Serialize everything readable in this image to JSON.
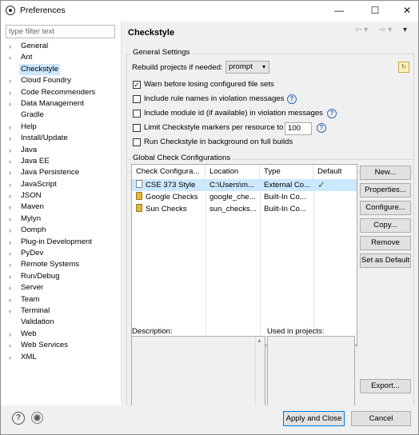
{
  "window": {
    "title": "Preferences"
  },
  "filter": {
    "placeholder": "type filter text"
  },
  "tree": [
    {
      "label": "General",
      "expandable": true
    },
    {
      "label": "Ant",
      "expandable": true
    },
    {
      "label": "Checkstyle",
      "expandable": false,
      "selected": true
    },
    {
      "label": "Cloud Foundry",
      "expandable": true
    },
    {
      "label": "Code Recommenders",
      "expandable": true
    },
    {
      "label": "Data Management",
      "expandable": true
    },
    {
      "label": "Gradle",
      "expandable": false
    },
    {
      "label": "Help",
      "expandable": true
    },
    {
      "label": "Install/Update",
      "expandable": true
    },
    {
      "label": "Java",
      "expandable": true
    },
    {
      "label": "Java EE",
      "expandable": true
    },
    {
      "label": "Java Persistence",
      "expandable": true
    },
    {
      "label": "JavaScript",
      "expandable": true
    },
    {
      "label": "JSON",
      "expandable": true
    },
    {
      "label": "Maven",
      "expandable": true
    },
    {
      "label": "Mylyn",
      "expandable": true
    },
    {
      "label": "Oomph",
      "expandable": true
    },
    {
      "label": "Plug-in Development",
      "expandable": true
    },
    {
      "label": "PyDev",
      "expandable": true
    },
    {
      "label": "Remote Systems",
      "expandable": true
    },
    {
      "label": "Run/Debug",
      "expandable": true
    },
    {
      "label": "Server",
      "expandable": true
    },
    {
      "label": "Team",
      "expandable": true
    },
    {
      "label": "Terminal",
      "expandable": true
    },
    {
      "label": "Validation",
      "expandable": false
    },
    {
      "label": "Web",
      "expandable": true
    },
    {
      "label": "Web Services",
      "expandable": true
    },
    {
      "label": "XML",
      "expandable": true
    }
  ],
  "page": {
    "title": "Checkstyle"
  },
  "general": {
    "group_label": "General Settings",
    "rebuild_label": "Rebuild projects if needed:",
    "rebuild_value": "prompt",
    "options": [
      {
        "label": "Warn before losing configured file sets",
        "checked": true,
        "help": false
      },
      {
        "label": "Include rule names in violation messages",
        "checked": false,
        "help": true
      },
      {
        "label": "Include module id (if available) in violation messages",
        "checked": false,
        "help": true
      },
      {
        "label": "Limit Checkstyle markers per resource to",
        "checked": false,
        "help": true,
        "value": "100"
      },
      {
        "label": "Run Checkstyle in background on full builds",
        "checked": false,
        "help": false
      }
    ]
  },
  "global": {
    "group_label": "Global Check Configurations",
    "columns": [
      "Check Configura...",
      "Location",
      "Type",
      "Default"
    ],
    "rows": [
      {
        "name": "CSE 373 Style",
        "location": "C:\\Users\\m...",
        "type": "External Co...",
        "default": "✓",
        "selected": true,
        "icon": "file-icon"
      },
      {
        "name": "Google Checks",
        "location": "google_che...",
        "type": "Built-In Co...",
        "default": "",
        "selected": false,
        "icon": "lock-icon"
      },
      {
        "name": "Sun Checks",
        "location": "sun_checks...",
        "type": "Built-In Co...",
        "default": "",
        "selected": false,
        "icon": "lock-icon"
      }
    ],
    "buttons": {
      "new": "New...",
      "properties": "Properties...",
      "configure": "Configure...",
      "copy": "Copy...",
      "remove": "Remove",
      "set_default": "Set as Default",
      "export": "Export..."
    },
    "description_label": "Description:",
    "used_label": "Used in projects:"
  },
  "footer": {
    "apply_close": "Apply and Close",
    "cancel": "Cancel"
  },
  "colors": {
    "selection": "#cce8ff",
    "accent": "#0078d7",
    "check": "#1a7f1a"
  }
}
